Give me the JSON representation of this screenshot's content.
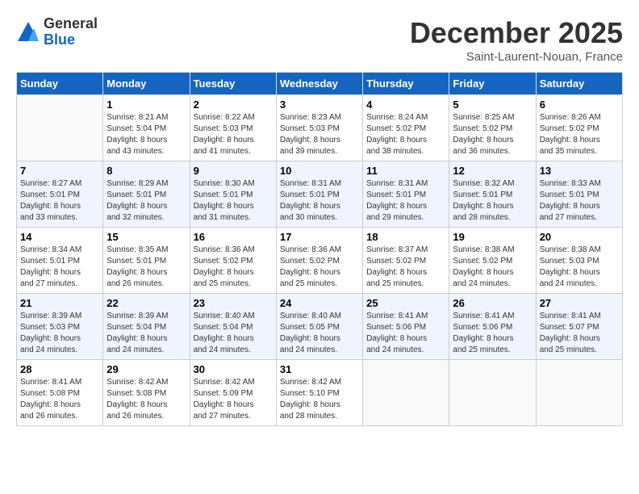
{
  "logo": {
    "general": "General",
    "blue": "Blue"
  },
  "title": "December 2025",
  "subtitle": "Saint-Laurent-Nouan, France",
  "days_of_week": [
    "Sunday",
    "Monday",
    "Tuesday",
    "Wednesday",
    "Thursday",
    "Friday",
    "Saturday"
  ],
  "weeks": [
    [
      {
        "day": "",
        "info": ""
      },
      {
        "day": "1",
        "info": "Sunrise: 8:21 AM\nSunset: 5:04 PM\nDaylight: 8 hours\nand 43 minutes."
      },
      {
        "day": "2",
        "info": "Sunrise: 8:22 AM\nSunset: 5:03 PM\nDaylight: 8 hours\nand 41 minutes."
      },
      {
        "day": "3",
        "info": "Sunrise: 8:23 AM\nSunset: 5:03 PM\nDaylight: 8 hours\nand 39 minutes."
      },
      {
        "day": "4",
        "info": "Sunrise: 8:24 AM\nSunset: 5:02 PM\nDaylight: 8 hours\nand 38 minutes."
      },
      {
        "day": "5",
        "info": "Sunrise: 8:25 AM\nSunset: 5:02 PM\nDaylight: 8 hours\nand 36 minutes."
      },
      {
        "day": "6",
        "info": "Sunrise: 8:26 AM\nSunset: 5:02 PM\nDaylight: 8 hours\nand 35 minutes."
      }
    ],
    [
      {
        "day": "7",
        "info": "Sunrise: 8:27 AM\nSunset: 5:01 PM\nDaylight: 8 hours\nand 33 minutes."
      },
      {
        "day": "8",
        "info": "Sunrise: 8:29 AM\nSunset: 5:01 PM\nDaylight: 8 hours\nand 32 minutes."
      },
      {
        "day": "9",
        "info": "Sunrise: 8:30 AM\nSunset: 5:01 PM\nDaylight: 8 hours\nand 31 minutes."
      },
      {
        "day": "10",
        "info": "Sunrise: 8:31 AM\nSunset: 5:01 PM\nDaylight: 8 hours\nand 30 minutes."
      },
      {
        "day": "11",
        "info": "Sunrise: 8:31 AM\nSunset: 5:01 PM\nDaylight: 8 hours\nand 29 minutes."
      },
      {
        "day": "12",
        "info": "Sunrise: 8:32 AM\nSunset: 5:01 PM\nDaylight: 8 hours\nand 28 minutes."
      },
      {
        "day": "13",
        "info": "Sunrise: 8:33 AM\nSunset: 5:01 PM\nDaylight: 8 hours\nand 27 minutes."
      }
    ],
    [
      {
        "day": "14",
        "info": "Sunrise: 8:34 AM\nSunset: 5:01 PM\nDaylight: 8 hours\nand 27 minutes."
      },
      {
        "day": "15",
        "info": "Sunrise: 8:35 AM\nSunset: 5:01 PM\nDaylight: 8 hours\nand 26 minutes."
      },
      {
        "day": "16",
        "info": "Sunrise: 8:36 AM\nSunset: 5:02 PM\nDaylight: 8 hours\nand 25 minutes."
      },
      {
        "day": "17",
        "info": "Sunrise: 8:36 AM\nSunset: 5:02 PM\nDaylight: 8 hours\nand 25 minutes."
      },
      {
        "day": "18",
        "info": "Sunrise: 8:37 AM\nSunset: 5:02 PM\nDaylight: 8 hours\nand 25 minutes."
      },
      {
        "day": "19",
        "info": "Sunrise: 8:38 AM\nSunset: 5:02 PM\nDaylight: 8 hours\nand 24 minutes."
      },
      {
        "day": "20",
        "info": "Sunrise: 8:38 AM\nSunset: 5:03 PM\nDaylight: 8 hours\nand 24 minutes."
      }
    ],
    [
      {
        "day": "21",
        "info": "Sunrise: 8:39 AM\nSunset: 5:03 PM\nDaylight: 8 hours\nand 24 minutes."
      },
      {
        "day": "22",
        "info": "Sunrise: 8:39 AM\nSunset: 5:04 PM\nDaylight: 8 hours\nand 24 minutes."
      },
      {
        "day": "23",
        "info": "Sunrise: 8:40 AM\nSunset: 5:04 PM\nDaylight: 8 hours\nand 24 minutes."
      },
      {
        "day": "24",
        "info": "Sunrise: 8:40 AM\nSunset: 5:05 PM\nDaylight: 8 hours\nand 24 minutes."
      },
      {
        "day": "25",
        "info": "Sunrise: 8:41 AM\nSunset: 5:06 PM\nDaylight: 8 hours\nand 24 minutes."
      },
      {
        "day": "26",
        "info": "Sunrise: 8:41 AM\nSunset: 5:06 PM\nDaylight: 8 hours\nand 25 minutes."
      },
      {
        "day": "27",
        "info": "Sunrise: 8:41 AM\nSunset: 5:07 PM\nDaylight: 8 hours\nand 25 minutes."
      }
    ],
    [
      {
        "day": "28",
        "info": "Sunrise: 8:41 AM\nSunset: 5:08 PM\nDaylight: 8 hours\nand 26 minutes."
      },
      {
        "day": "29",
        "info": "Sunrise: 8:42 AM\nSunset: 5:08 PM\nDaylight: 8 hours\nand 26 minutes."
      },
      {
        "day": "30",
        "info": "Sunrise: 8:42 AM\nSunset: 5:09 PM\nDaylight: 8 hours\nand 27 minutes."
      },
      {
        "day": "31",
        "info": "Sunrise: 8:42 AM\nSunset: 5:10 PM\nDaylight: 8 hours\nand 28 minutes."
      },
      {
        "day": "",
        "info": ""
      },
      {
        "day": "",
        "info": ""
      },
      {
        "day": "",
        "info": ""
      }
    ]
  ]
}
